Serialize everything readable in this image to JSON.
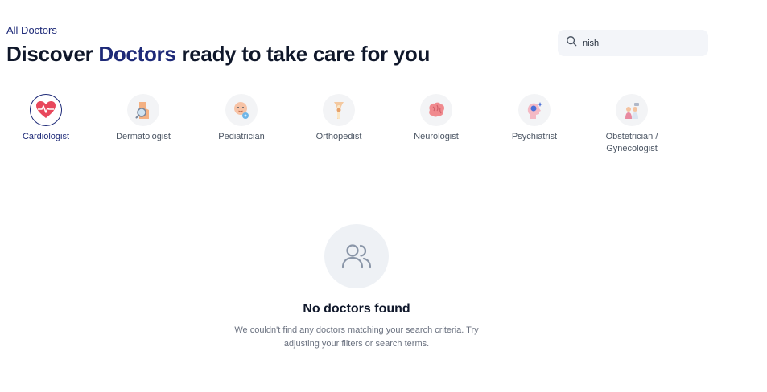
{
  "breadcrumb": "All Doctors",
  "title": {
    "prefix": "Discover ",
    "accent": "Doctors",
    "suffix": " ready to take care for you"
  },
  "search": {
    "value": "nish",
    "icon": "search-icon"
  },
  "categories": [
    {
      "label": "Cardiologist",
      "icon": "heart-icon",
      "active": true
    },
    {
      "label": "Dermatologist",
      "icon": "skin-magnifier-icon",
      "active": false
    },
    {
      "label": "Pediatrician",
      "icon": "baby-icon",
      "active": false
    },
    {
      "label": "Orthopedist",
      "icon": "bone-joint-icon",
      "active": false
    },
    {
      "label": "Neurologist",
      "icon": "brain-icon",
      "active": false
    },
    {
      "label": "Psychiatrist",
      "icon": "head-mind-icon",
      "active": false
    },
    {
      "label": "Obstetrician / Gynecologist",
      "icon": "mother-doctor-icon",
      "active": false
    }
  ],
  "empty_state": {
    "icon": "users-icon",
    "title": "No doctors found",
    "description": "We couldn't find any doctors matching your search criteria. Try adjusting your filters or search terms."
  },
  "colors": {
    "accent": "#1e2a78",
    "title": "#0f172a",
    "muted": "#6b7280",
    "search_bg": "#f3f5f9"
  }
}
